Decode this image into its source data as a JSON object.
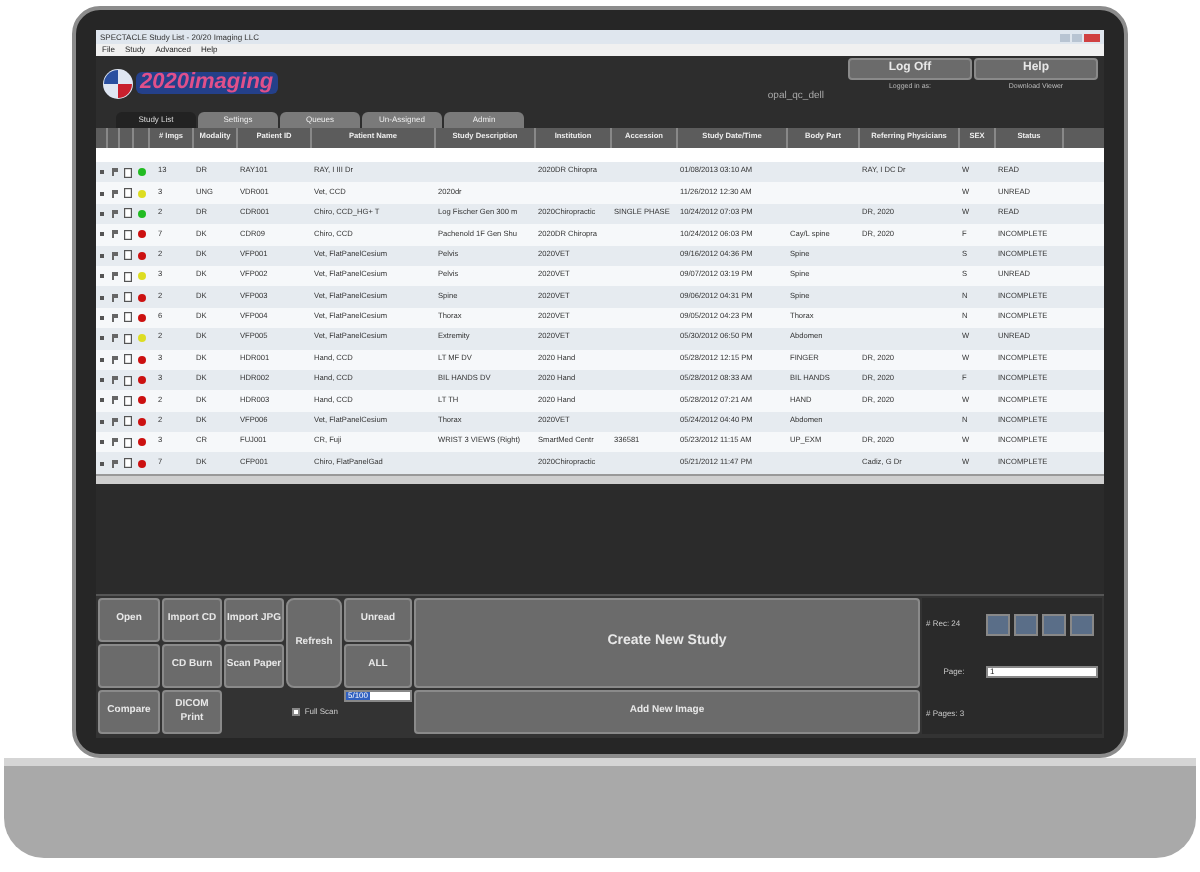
{
  "window": {
    "title": "SPECTACLE Study List - 20/20 Imaging LLC"
  },
  "menu": [
    "File",
    "Study",
    "Advanced",
    "Help"
  ],
  "header": {
    "logo_text": "2020imaging",
    "user": "opal_qc_dell",
    "buttons": [
      {
        "label": "Log Off",
        "caption": "Logged in as:"
      },
      {
        "label": "Help",
        "caption": "Download Viewer"
      }
    ]
  },
  "tabs": [
    {
      "label": "Study List",
      "selected": true
    },
    {
      "label": "Settings",
      "selected": false
    },
    {
      "label": "Queues",
      "selected": false
    },
    {
      "label": "Un-Assigned",
      "selected": false
    },
    {
      "label": "Admin",
      "selected": false
    }
  ],
  "table": {
    "columns": [
      "# Imgs",
      "Modality",
      "Patient ID",
      "Patient Name",
      "Study Description",
      "Institution",
      "Accession",
      "Study Date/Time",
      "Body Part",
      "Referring Physicians",
      "SEX",
      "Status"
    ],
    "rows": [
      {
        "color": "#22bb22",
        "cells": [
          "13",
          "DR",
          "RAY101",
          "RAY, I III Dr",
          "",
          "2020DR Chiropra",
          "",
          "01/08/2013 03:10 AM",
          "",
          "RAY, I DC Dr",
          "W",
          "READ"
        ]
      },
      {
        "color": "#dddd22",
        "cells": [
          "3",
          "UNG",
          "VDR001",
          "Vet, CCD",
          "2020dr",
          "",
          "",
          "11/26/2012 12:30 AM",
          "",
          "",
          "W",
          "UNREAD"
        ]
      },
      {
        "color": "#22bb22",
        "cells": [
          "2",
          "DR",
          "CDR001",
          "Chiro, CCD_HG+ T",
          "Log Fischer Gen 300 m",
          "2020Chiropractic",
          "SINGLE PHASE",
          "10/24/2012 07:03 PM",
          "",
          "DR, 2020",
          "W",
          "READ"
        ]
      },
      {
        "color": "#cc1111",
        "cells": [
          "7",
          "DK",
          "CDR09",
          "Chiro, CCD",
          "Pachenold 1F Gen Shu",
          "2020DR Chiropra",
          "",
          "10/24/2012 06:03 PM",
          "Cay/L spine",
          "DR, 2020",
          "F",
          "INCOMPLETE"
        ]
      },
      {
        "color": "#cc1111",
        "cells": [
          "2",
          "DK",
          "VFP001",
          "Vet, FlatPanelCesium",
          "Pelvis",
          "2020VET",
          "",
          "09/16/2012 04:36 PM",
          "Spine",
          "",
          "S",
          "INCOMPLETE"
        ]
      },
      {
        "color": "#dddd22",
        "cells": [
          "3",
          "DK",
          "VFP002",
          "Vet, FlatPanelCesium",
          "Pelvis",
          "2020VET",
          "",
          "09/07/2012 03:19 PM",
          "Spine",
          "",
          "S",
          "UNREAD"
        ]
      },
      {
        "color": "#cc1111",
        "cells": [
          "2",
          "DK",
          "VFP003",
          "Vet, FlatPanelCesium",
          "Spine",
          "2020VET",
          "",
          "09/06/2012 04:31 PM",
          "Spine",
          "",
          "N",
          "INCOMPLETE"
        ]
      },
      {
        "color": "#cc1111",
        "cells": [
          "6",
          "DK",
          "VFP004",
          "Vet, FlatPanelCesium",
          "Thorax",
          "2020VET",
          "",
          "09/05/2012 04:23 PM",
          "Thorax",
          "",
          "N",
          "INCOMPLETE"
        ]
      },
      {
        "color": "#dddd22",
        "cells": [
          "2",
          "DK",
          "VFP005",
          "Vet, FlatPanelCesium",
          "Extremity",
          "2020VET",
          "",
          "05/30/2012 06:50 PM",
          "Abdomen",
          "",
          "W",
          "UNREAD"
        ]
      },
      {
        "color": "#cc1111",
        "cells": [
          "3",
          "DK",
          "HDR001",
          "Hand, CCD",
          "LT MF DV",
          "2020 Hand",
          "",
          "05/28/2012 12:15 PM",
          "FINGER",
          "DR, 2020",
          "W",
          "INCOMPLETE"
        ]
      },
      {
        "color": "#cc1111",
        "cells": [
          "3",
          "DK",
          "HDR002",
          "Hand, CCD",
          "BIL HANDS DV",
          "2020 Hand",
          "",
          "05/28/2012 08:33 AM",
          "BIL HANDS",
          "DR, 2020",
          "F",
          "INCOMPLETE"
        ]
      },
      {
        "color": "#cc1111",
        "cells": [
          "2",
          "DK",
          "HDR003",
          "Hand, CCD",
          "LT TH",
          "2020 Hand",
          "",
          "05/28/2012 07:21 AM",
          "HAND",
          "DR, 2020",
          "W",
          "INCOMPLETE"
        ]
      },
      {
        "color": "#cc1111",
        "cells": [
          "2",
          "DK",
          "VFP006",
          "Vet, FlatPanelCesium",
          "Thorax",
          "2020VET",
          "",
          "05/24/2012 04:40 PM",
          "Abdomen",
          "",
          "N",
          "INCOMPLETE"
        ]
      },
      {
        "color": "#cc1111",
        "cells": [
          "3",
          "CR",
          "FUJ001",
          "CR, Fuji",
          "WRIST 3 VIEWS (Right)",
          "SmartMed Centr",
          "336581",
          "05/23/2012 11:15 AM",
          "UP_EXM",
          "DR, 2020",
          "W",
          "INCOMPLETE"
        ]
      },
      {
        "color": "#cc1111",
        "cells": [
          "7",
          "DK",
          "CFP001",
          "Chiro, FlatPanelGad",
          "",
          "2020Chiropractic",
          "",
          "05/21/2012 11:47 PM",
          "",
          "Cadiz, G Dr",
          "W",
          "INCOMPLETE"
        ]
      }
    ]
  },
  "toolbar": {
    "open": "Open",
    "import_cd": "Import CD",
    "import_jpg": "Import JPG",
    "refresh": "Refresh",
    "unread": "Unread",
    "all": "ALL",
    "create": "Create New Study",
    "cd_burn": "CD Burn",
    "scan_paper": "Scan Paper",
    "compare": "Compare",
    "dicom_print": "DICOM Print",
    "add_image": "Add New Image",
    "full_scan": {
      "label": "Full Scan",
      "checked": false
    },
    "range": "5/100"
  },
  "paging": {
    "records": "# Rec: 24",
    "page_label": "Page:",
    "page": "1",
    "pages": "# Pages: 3"
  }
}
